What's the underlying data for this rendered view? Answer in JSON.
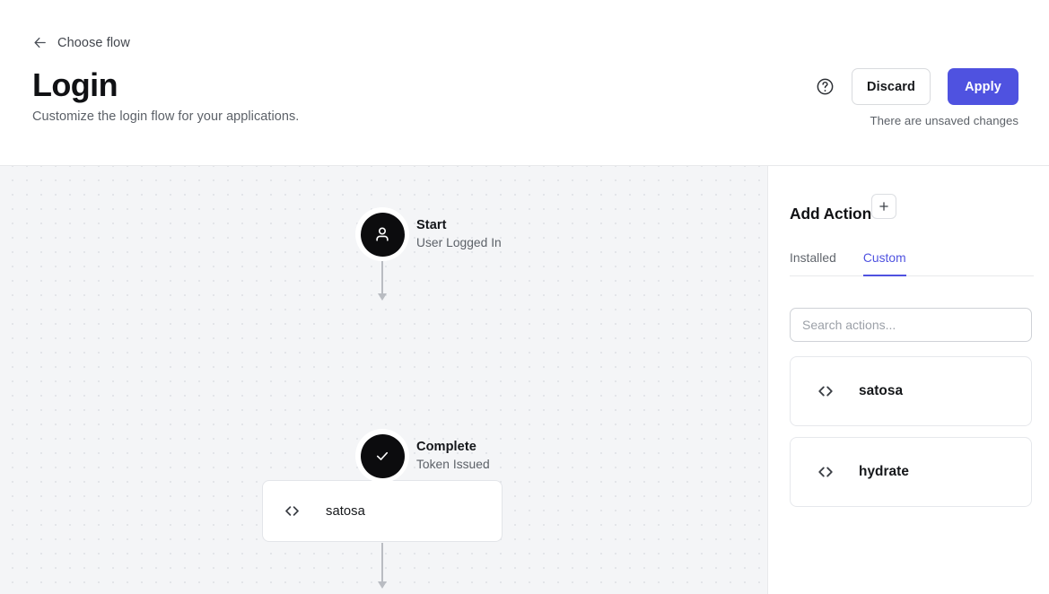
{
  "theme": {
    "accent": "#4f52e0",
    "canvas_bg": "#f4f5f7",
    "dot": "#e3e5e9",
    "node_dark": "#0c0c0e"
  },
  "header": {
    "back_label": "Choose flow",
    "back_icon": "arrow-left-icon",
    "title": "Login",
    "subtitle": "Customize the login flow for your applications.",
    "help_icon": "help-circle-icon",
    "discard_label": "Discard",
    "apply_label": "Apply",
    "unsaved_note": "There are unsaved changes"
  },
  "flow": {
    "start": {
      "title": "Start",
      "description": "User Logged In",
      "icon": "user-icon"
    },
    "steps": [
      {
        "label": "satosa",
        "icon": "code-brackets-icon"
      }
    ],
    "complete": {
      "title": "Complete",
      "description": "Token Issued",
      "icon": "check-icon"
    }
  },
  "sidebar": {
    "title": "Add Action",
    "add_icon": "plus-icon",
    "tabs": [
      {
        "label": "Installed",
        "active": false
      },
      {
        "label": "Custom",
        "active": true
      }
    ],
    "search": {
      "placeholder": "Search actions...",
      "value": ""
    },
    "actions": [
      {
        "label": "satosa",
        "icon": "code-brackets-icon"
      },
      {
        "label": "hydrate",
        "icon": "code-brackets-icon"
      }
    ]
  }
}
